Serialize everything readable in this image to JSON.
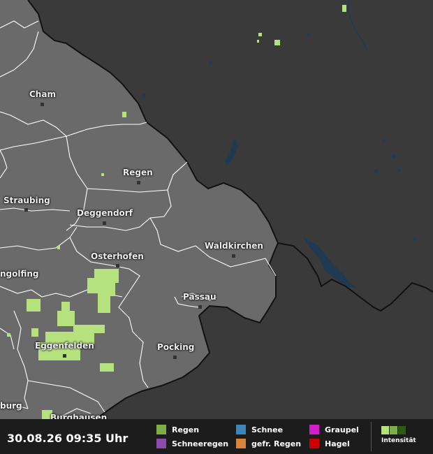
{
  "colors": {
    "land_germany": "#6a6a6a",
    "land_outside": "#3a3a3a",
    "water": "#1f3a52",
    "border": "#111111",
    "district_line": "#ffffff",
    "rain": "#b6e27e",
    "intensity": [
      "#b6e27e",
      "#7fae48",
      "#2f5a15"
    ]
  },
  "places": [
    {
      "id": "cham",
      "name": "Cham"
    },
    {
      "id": "regen",
      "name": "Regen"
    },
    {
      "id": "straubing",
      "name": "Straubing"
    },
    {
      "id": "deggendorf",
      "name": "Deggendorf"
    },
    {
      "id": "waldkirchen",
      "name": "Waldkirchen"
    },
    {
      "id": "osterhofen",
      "name": "Osterhofen"
    },
    {
      "id": "dingolfing",
      "name": "ngolfing"
    },
    {
      "id": "passau",
      "name": "Passau"
    },
    {
      "id": "eggenfelden",
      "name": "Eggenfelden"
    },
    {
      "id": "pocking",
      "name": "Pocking"
    },
    {
      "id": "burghausen",
      "name": "Burghausen"
    },
    {
      "id": "altoetting",
      "name": "burg"
    }
  ],
  "footer": {
    "timestamp": "30.08.26 09:35 Uhr",
    "legend": [
      {
        "id": "regen",
        "label": "Regen",
        "color": "#7fae48"
      },
      {
        "id": "schneeregen",
        "label": "Schneeregen",
        "color": "#8e4aa8"
      },
      {
        "id": "schnee",
        "label": "Schnee",
        "color": "#3f86b8"
      },
      {
        "id": "gefr-regen",
        "label": "gefr. Regen",
        "color": "#d9843c"
      },
      {
        "id": "graupel",
        "label": "Graupel",
        "color": "#d41fc8"
      },
      {
        "id": "hagel",
        "label": "Hagel",
        "color": "#cc0000"
      }
    ],
    "intensity_label": "Intensität"
  }
}
